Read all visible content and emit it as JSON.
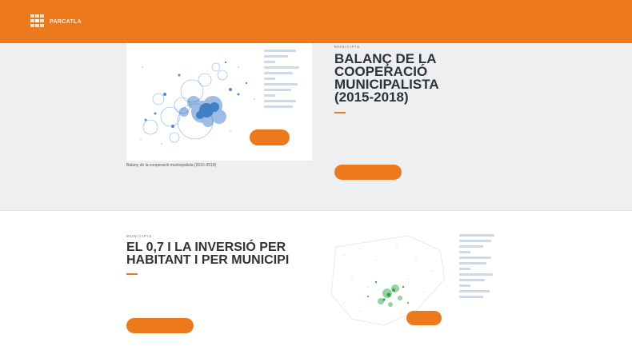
{
  "header": {
    "logo": {
      "line1": "PARCATLA",
      "line2": ""
    },
    "nav": []
  },
  "section1": {
    "kicker": "MUNICIPIS",
    "title": "BALANÇ DE LA COOPERACIÓ MUNICIPALISTA (2015-2018)",
    "body": "",
    "map_caption": "Balanç de la cooperació municipalista (2015-2018)",
    "map_badge": "",
    "cta": ""
  },
  "section2": {
    "kicker": "MUNICIPIS",
    "title": "EL 0,7 I LA INVERSIÓ PER HABITANT I PER MUNICIPI",
    "body": "",
    "map_caption": "",
    "map_badge": "",
    "cta": ""
  },
  "colors": {
    "brand_orange": "#ec7a1c",
    "section_bg": "#edeff1",
    "title": "#2f3337",
    "map_blue": "#2b6fc2",
    "map_green": "#2fa84a"
  }
}
